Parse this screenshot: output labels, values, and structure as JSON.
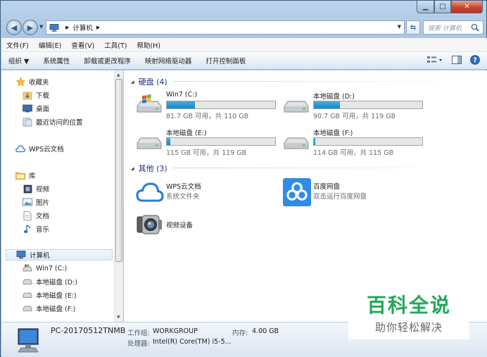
{
  "window": {
    "caption": {
      "minimize": "▁",
      "maximize": "□",
      "close": "✕"
    }
  },
  "address_bar": {
    "breadcrumb": "计算机",
    "search_placeholder": "搜索 计算机"
  },
  "menu": [
    "文件(F)",
    "编辑(E)",
    "查看(V)",
    "工具(T)",
    "帮助(H)"
  ],
  "commands": [
    "组织 ▼",
    "系统属性",
    "卸载或更改程序",
    "映射网络驱动器",
    "打开控制面板"
  ],
  "nav": {
    "favorites": "收藏夹",
    "downloads": "下载",
    "desktop": "桌面",
    "recent": "最近访问的位置",
    "wps": "WPS云文档",
    "libraries": "库",
    "videos": "视频",
    "pictures": "图片",
    "documents": "文档",
    "music": "音乐",
    "computer": "计算机",
    "drive_c": "Win7 (C:)",
    "drive_d": "本地磁盘 (D:)",
    "drive_e": "本地磁盘 (E:)",
    "drive_f": "本地磁盘 (F:)"
  },
  "groups": {
    "drives": "硬盘 (4)",
    "other": "其他 (3)"
  },
  "drives": [
    {
      "name": "Win7 (C:)",
      "info": "81.7 GB 可用，共 110 GB",
      "used_fraction": 0.26
    },
    {
      "name": "本地磁盘 (D:)",
      "info": "90.7 GB 可用，共 119 GB",
      "used_fraction": 0.24
    },
    {
      "name": "本地磁盘 (E:)",
      "info": "115 GB 可用，共 119 GB",
      "used_fraction": 0.03
    },
    {
      "name": "本地磁盘 (F:)",
      "info": "114 GB 可用，共 115 GB",
      "used_fraction": 0.01
    }
  ],
  "others": [
    {
      "name": "WPS云文档",
      "sub": "系统文件夹"
    },
    {
      "name": "百度网盘",
      "sub": "双击运行百度网盘"
    },
    {
      "name": "视频设备",
      "sub": ""
    }
  ],
  "details": {
    "pc_name": "PC-20170512TNMB",
    "workgroup_label": "工作组:",
    "workgroup": "WORKGROUP",
    "memory_label": "内存:",
    "memory": "4.00 GB",
    "cpu_label": "处理器:",
    "cpu": "Intel(R) Core(TM) i5-5..."
  },
  "watermark": {
    "title": "百科全说",
    "subtitle": "助你轻松解决"
  }
}
